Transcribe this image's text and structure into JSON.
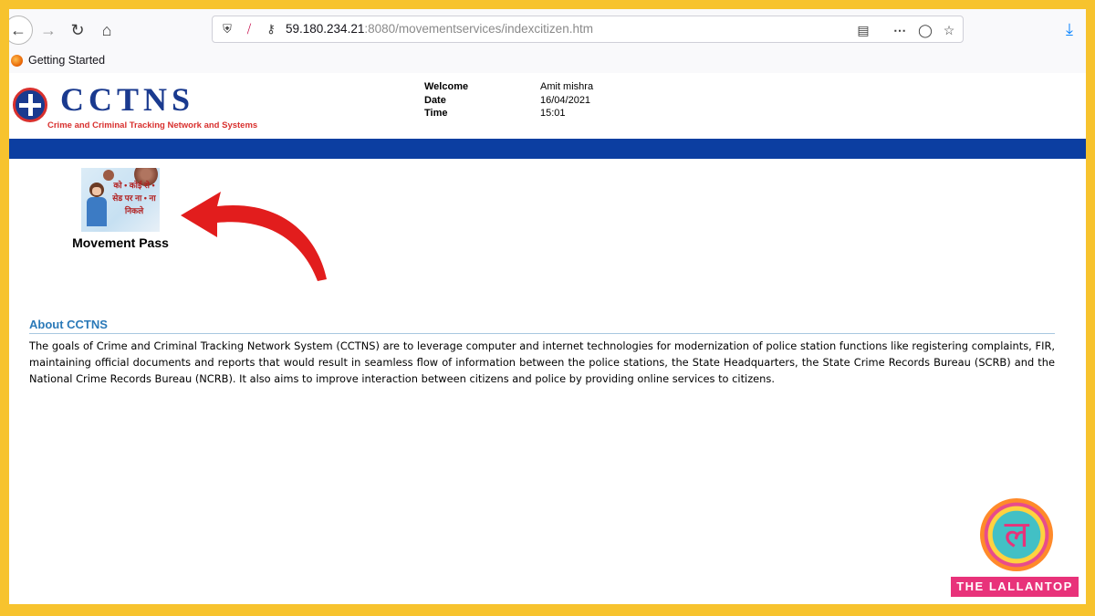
{
  "browser": {
    "url_host": "59.180.234.21",
    "url_rest": ":8080/movementservices/indexcitizen.htm",
    "bookmark": "Getting Started"
  },
  "header": {
    "logo_title": "CCTNS",
    "logo_subtitle": "Crime and Criminal Tracking Network and Systems",
    "welcome_label": "Welcome",
    "welcome_value": "Amit mishra",
    "date_label": "Date",
    "date_value": "16/04/2021",
    "time_label": "Time",
    "time_value": "15:01"
  },
  "colors": {
    "band": "#0c3ea1",
    "frame": "#f7c32e",
    "accent_link": "#2a79b8",
    "arrow": "#e21d1d"
  },
  "services": {
    "movement_pass_label": "Movement Pass",
    "poster_text": "को • कोई रो • सेड पर ना • ना निकले"
  },
  "about": {
    "title": "About CCTNS",
    "text": "The goals of Crime and Criminal Tracking Network System (CCTNS) are to leverage computer and internet technologies for modernization of police station functions like registering complaints, FIR, maintaining official documents and reports that would result in seamless flow of information between the police stations, the State Headquarters, the State Crime Records Bureau (SCRB) and the National Crime Records Bureau (NCRB). It also aims to improve interaction between citizens and police by providing online services to citizens."
  },
  "watermark": {
    "brand": "THE LALLANTOP"
  }
}
